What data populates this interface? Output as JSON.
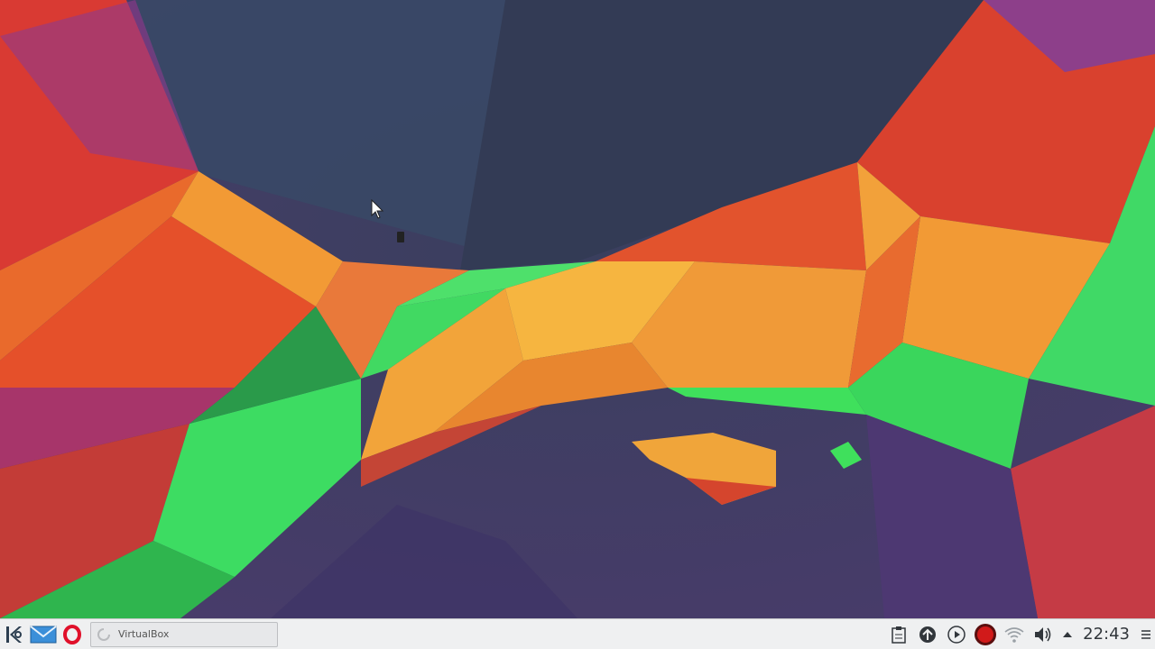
{
  "desktop": {
    "wallpaper": "abstract-polygon-wallpaper",
    "colors": {
      "orange": "#f0a030",
      "red": "#e2432b",
      "green": "#3fe05c",
      "purple": "#4a3770",
      "slate": "#33455a"
    }
  },
  "taskbar": {
    "launchers": [
      {
        "name": "kde-menu-icon"
      },
      {
        "name": "mail-icon"
      },
      {
        "name": "opera-icon"
      }
    ],
    "task": {
      "label": "VirtualBox",
      "icon": "loading-spinner-icon"
    },
    "tray": {
      "icons": [
        "clipboard-icon",
        "package-updates-icon",
        "media-player-icon",
        "record-icon",
        "wifi-icon",
        "volume-icon",
        "expand-tray-arrow-icon"
      ],
      "clock": "22:43",
      "menu_icon": "panel-menu-icon"
    }
  }
}
